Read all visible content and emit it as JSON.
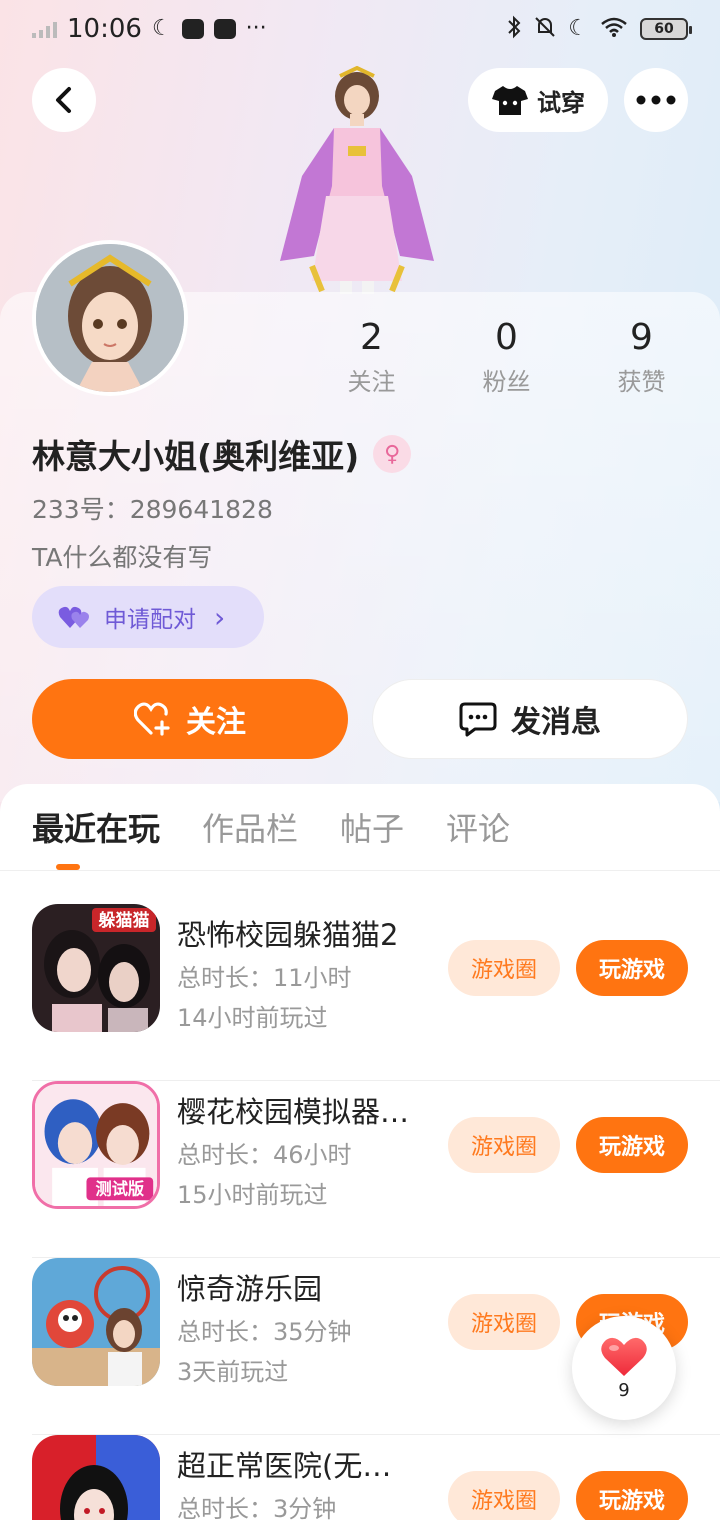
{
  "status_bar": {
    "time": "10:06",
    "battery": "60",
    "icons": [
      "signal-icon",
      "moon-icon",
      "mail-icon",
      "music-icon",
      "more-dots-icon",
      "bluetooth-icon",
      "silent-bell-icon",
      "moon-icon",
      "wifi-icon",
      "battery-icon"
    ],
    "dots": "···"
  },
  "header": {
    "tryon_label": "试穿"
  },
  "profile": {
    "stats": [
      {
        "value": "2",
        "label": "关注"
      },
      {
        "value": "0",
        "label": "粉丝"
      },
      {
        "value": "9",
        "label": "获赞"
      }
    ],
    "name": "林意大小姐(奥利维亚)",
    "gender_symbol": "♀",
    "uid": "233号：289641828",
    "bio": "TA什么都没有写",
    "pair_label": "申请配对",
    "pair_arrow": "›",
    "follow_label": "关注",
    "message_label": "发消息"
  },
  "tabs": [
    {
      "label": "最近在玩",
      "active": true
    },
    {
      "label": "作品栏",
      "active": false
    },
    {
      "label": "帖子",
      "active": false
    },
    {
      "label": "评论",
      "active": false
    }
  ],
  "games": [
    {
      "title": "恐怖校园躲猫猫2",
      "duration": "总时长：11小时",
      "last_played": "14小时前玩过",
      "circle_label": "游戏圈",
      "play_label": "玩游戏",
      "icon_badge": "躲猫猫"
    },
    {
      "title": "樱花校园模拟器…",
      "duration": "总时长：46小时",
      "last_played": "15小时前玩过",
      "circle_label": "游戏圈",
      "play_label": "玩游戏",
      "icon_badge": "测试版"
    },
    {
      "title": "惊奇游乐园",
      "duration": "总时长：35分钟",
      "last_played": "3天前玩过",
      "circle_label": "游戏圈",
      "play_label": "玩游戏",
      "icon_badge": ""
    },
    {
      "title": "超正常医院(无…",
      "duration": "总时长：3分钟",
      "last_played": "",
      "circle_label": "游戏圈",
      "play_label": "玩游戏",
      "icon_badge": ""
    }
  ],
  "like_float": {
    "count": "9"
  },
  "colors": {
    "accent": "#ff7411",
    "accent_light": "#ffe8d8",
    "pair_bg": "#e3defa",
    "pair_text": "#6f5ad6"
  }
}
